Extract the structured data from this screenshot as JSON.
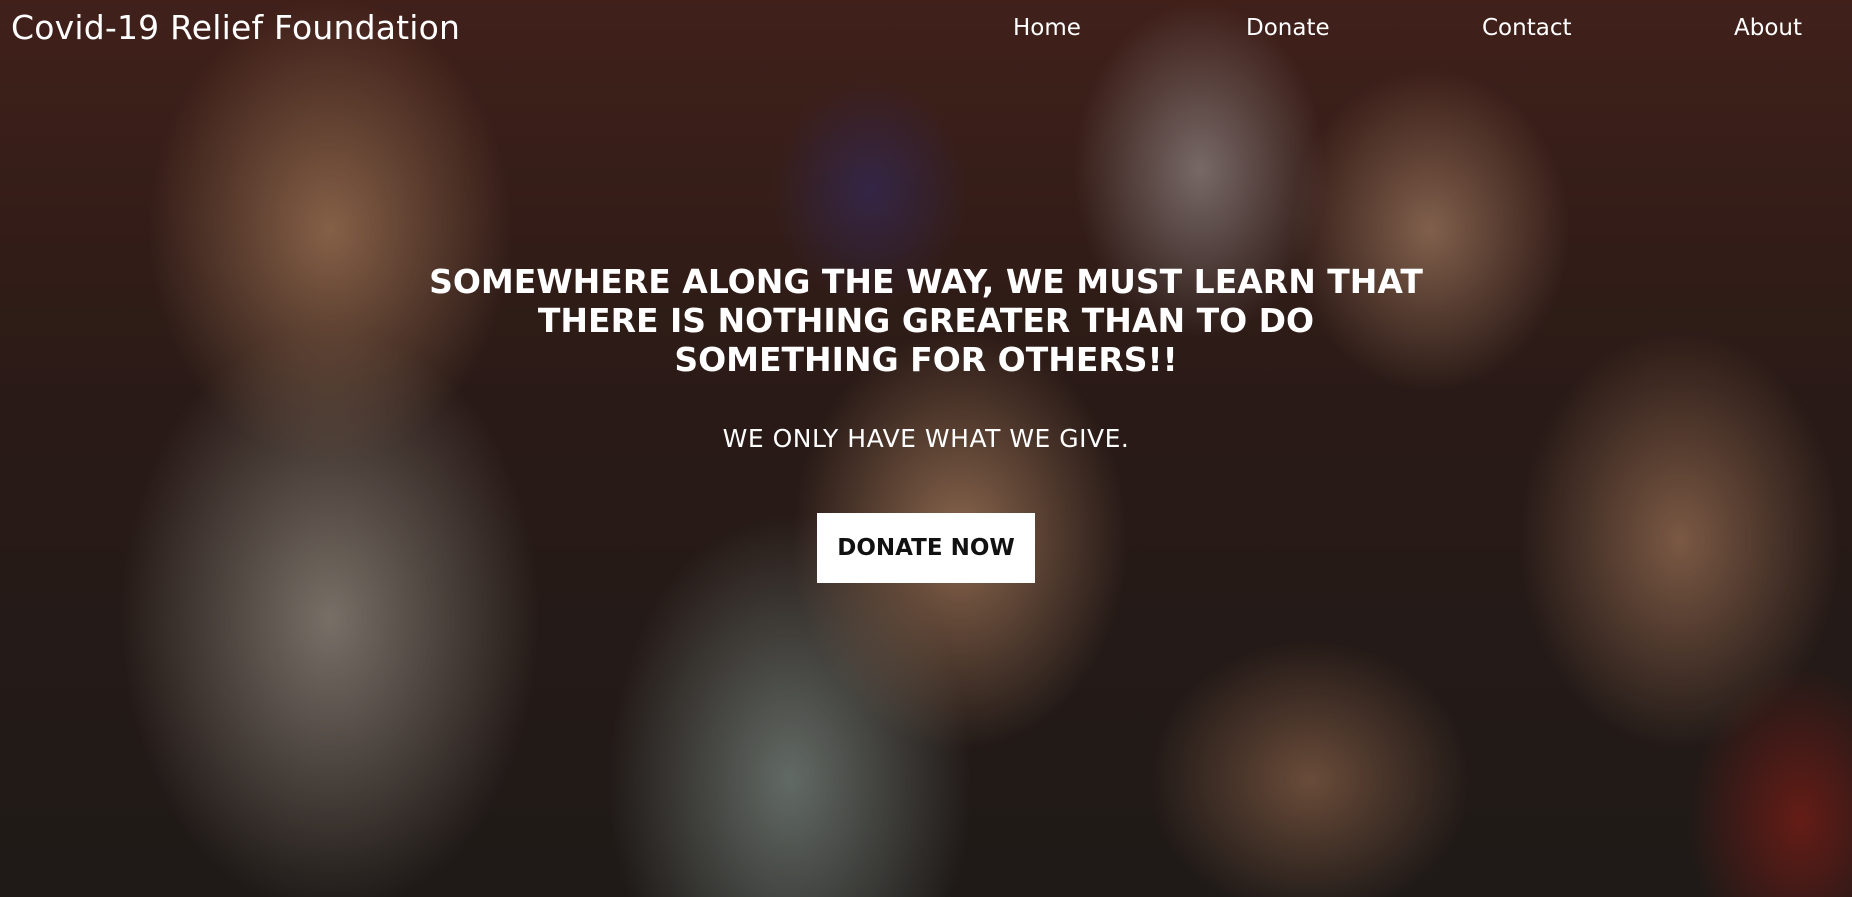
{
  "header": {
    "brand": "Covid-19 Relief Foundation",
    "nav": {
      "home": "Home",
      "donate": "Donate",
      "contact": "Contact",
      "about": "About"
    }
  },
  "hero": {
    "headline": "SOMEWHERE ALONG THE WAY, WE MUST LEARN THAT THERE IS NOTHING GREATER THAN TO DO SOMETHING FOR OTHERS!!",
    "subline": "WE ONLY HAVE WHAT WE GIVE.",
    "cta_label": "DONATE NOW"
  },
  "colors": {
    "text": "#ffffff",
    "button_bg": "#ffffff",
    "button_text": "#111111"
  }
}
